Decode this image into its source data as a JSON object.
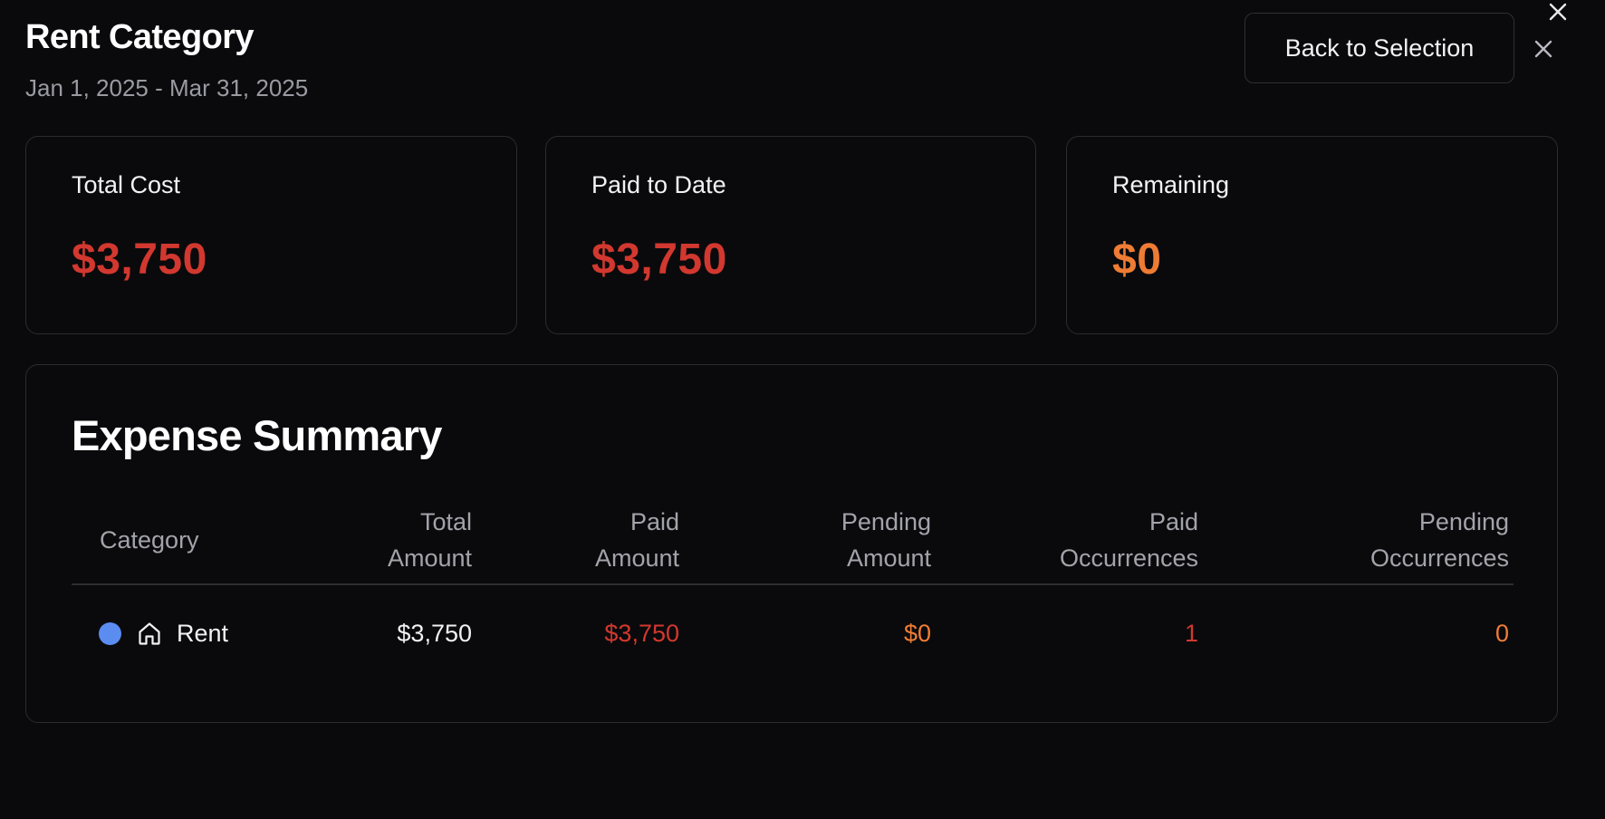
{
  "header": {
    "title": "Rent Category",
    "date_range": "Jan 1, 2025 - Mar 31, 2025",
    "back_button_label": "Back to Selection"
  },
  "icons": {
    "top_close": "close-icon",
    "dialog_close": "close-icon",
    "category_home": "home-icon"
  },
  "cards": [
    {
      "label": "Total Cost",
      "value": "$3,750",
      "color": "#d2382f"
    },
    {
      "label": "Paid to Date",
      "value": "$3,750",
      "color": "#d2382f"
    },
    {
      "label": "Remaining",
      "value": "$0",
      "color": "#ef7c34"
    }
  ],
  "summary": {
    "title": "Expense Summary",
    "columns": [
      {
        "line1": "Category",
        "line2": ""
      },
      {
        "line1": "Total",
        "line2": "Amount"
      },
      {
        "line1": "Paid",
        "line2": "Amount"
      },
      {
        "line1": "Pending",
        "line2": "Amount"
      },
      {
        "line1": "Paid",
        "line2": "Occurrences"
      },
      {
        "line1": "Pending",
        "line2": "Occurrences"
      }
    ],
    "rows": [
      {
        "category": "Rent",
        "category_color": "#5b8cf0",
        "icon": "home-icon",
        "total_amount": "$3,750",
        "paid_amount": "$3,750",
        "pending_amount": "$0",
        "paid_occurrences": "1",
        "pending_occurrences": "0"
      }
    ]
  },
  "colors": {
    "background": "#0a0a0c",
    "paid_red": "#d2382f",
    "pending_orange": "#ef7c34",
    "category_blue": "#5b8cf0",
    "text_primary": "#f2f2f4",
    "text_muted": "#9a9aa2"
  }
}
